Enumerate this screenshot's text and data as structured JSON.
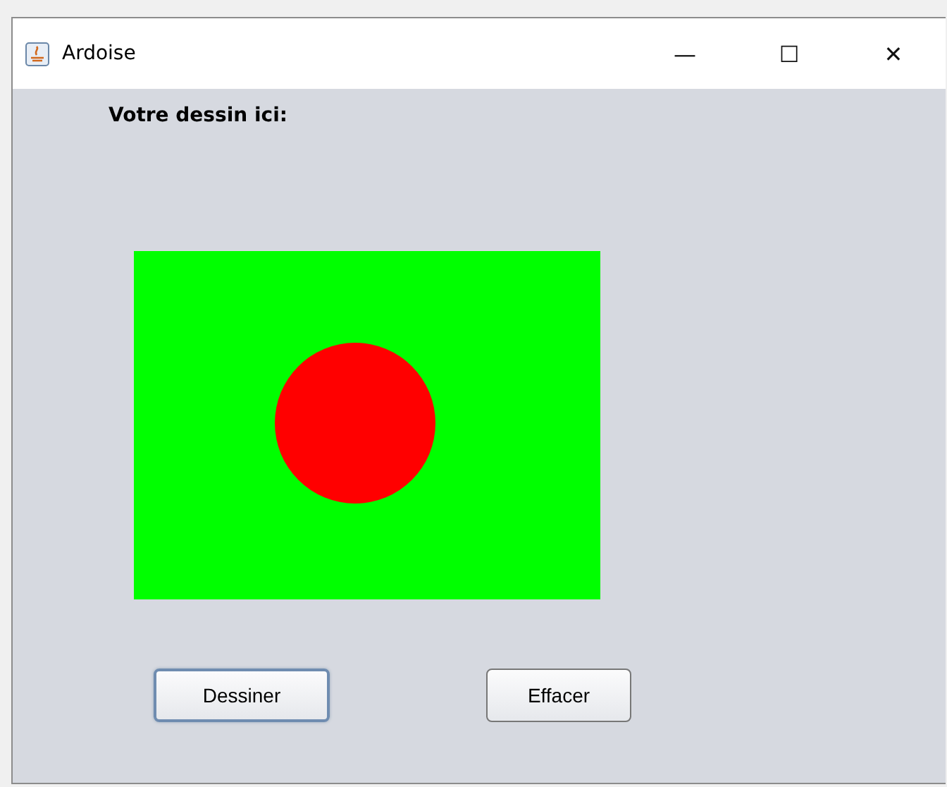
{
  "window": {
    "title": "Ardoise",
    "controls": [
      "—",
      "☐",
      "✕"
    ]
  },
  "label": "Votre dessin ici:",
  "buttons": [
    {
      "label": "Dessiner",
      "focused": true
    },
    {
      "label": "Effacer",
      "focused": false
    }
  ]
}
